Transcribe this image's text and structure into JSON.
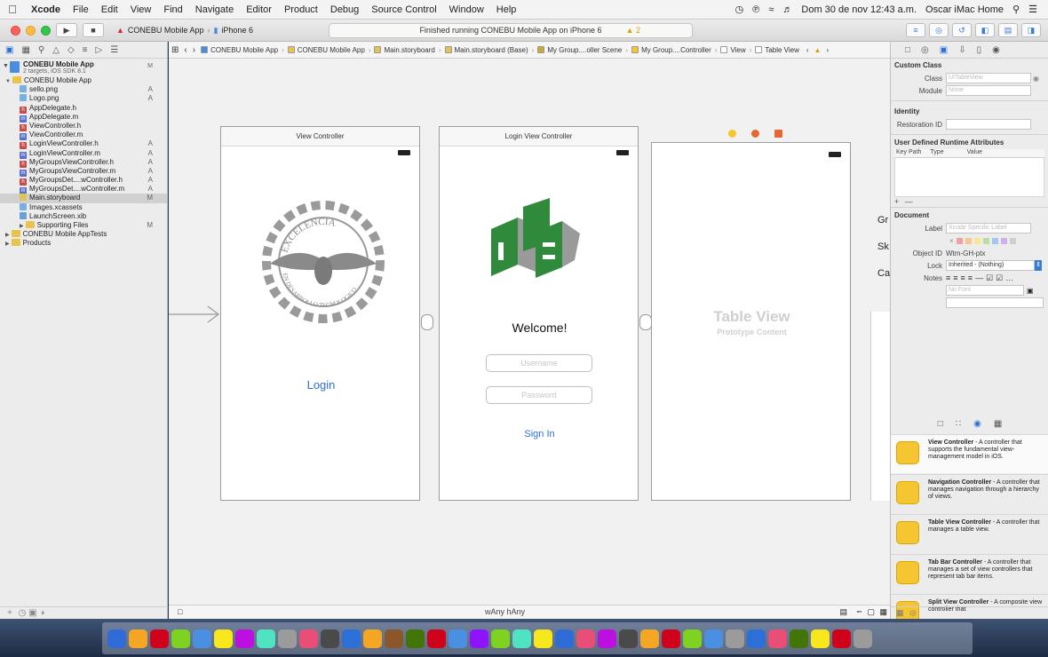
{
  "menubar": {
    "app": "Xcode",
    "items": [
      "File",
      "Edit",
      "View",
      "Find",
      "Navigate",
      "Editor",
      "Product",
      "Debug",
      "Source Control",
      "Window",
      "Help"
    ],
    "clock": "Dom 30 de nov  12:43 a.m.",
    "user": "Oscar iMac Home"
  },
  "toolbar": {
    "scheme": "CONEBU Mobile App",
    "device": "iPhone 6",
    "status": "Finished running CONEBU Mobile App on iPhone 6",
    "warning_count": "2"
  },
  "navigator": {
    "project_name": "CONEBU Mobile App",
    "project_sub": "2 targets, iOS SDK 8.1",
    "project_badge": "M",
    "items": [
      {
        "name": "CONEBU Mobile App",
        "type": "folder",
        "indent": 1,
        "status": ""
      },
      {
        "name": "sello.png",
        "type": "img",
        "indent": 2,
        "status": "A"
      },
      {
        "name": "Logo.png",
        "type": "img",
        "indent": 2,
        "status": "A"
      },
      {
        "name": "AppDelegate.h",
        "type": "h",
        "indent": 2,
        "status": ""
      },
      {
        "name": "AppDelegate.m",
        "type": "m",
        "indent": 2,
        "status": ""
      },
      {
        "name": "ViewController.h",
        "type": "h",
        "indent": 2,
        "status": ""
      },
      {
        "name": "ViewController.m",
        "type": "m",
        "indent": 2,
        "status": ""
      },
      {
        "name": "LoginViewController.h",
        "type": "h",
        "indent": 2,
        "status": "A"
      },
      {
        "name": "LoginViewController.m",
        "type": "m",
        "indent": 2,
        "status": "A"
      },
      {
        "name": "MyGroupsViewController.h",
        "type": "h",
        "indent": 2,
        "status": "A"
      },
      {
        "name": "MyGroupsViewController.m",
        "type": "m",
        "indent": 2,
        "status": "A"
      },
      {
        "name": "MyGroupsDet....wController.h",
        "type": "h",
        "indent": 2,
        "status": "A"
      },
      {
        "name": "MyGroupsDet....wController.m",
        "type": "m",
        "indent": 2,
        "status": "A"
      },
      {
        "name": "Main.storyboard",
        "type": "sb",
        "indent": 2,
        "status": "M",
        "selected": true
      },
      {
        "name": "Images.xcassets",
        "type": "img",
        "indent": 2,
        "status": ""
      },
      {
        "name": "LaunchScreen.xib",
        "type": "xib",
        "indent": 2,
        "status": ""
      },
      {
        "name": "Supporting Files",
        "type": "folder",
        "indent": 2,
        "status": "M"
      },
      {
        "name": "CONEBU Mobile AppTests",
        "type": "folder",
        "indent": 1,
        "status": ""
      },
      {
        "name": "Products",
        "type": "folder",
        "indent": 1,
        "status": ""
      }
    ]
  },
  "jumpbar": {
    "crumbs": [
      "CONEBU Mobile App",
      "CONEBU Mobile App",
      "Main.storyboard",
      "Main.storyboard (Base)",
      "My Group....oller Scene",
      "My Group....Controller",
      "View",
      "Table View"
    ]
  },
  "canvas": {
    "scene1_title": "View Controller",
    "seal_text_top": "EXCELENCIA",
    "seal_text_bottom": "EN DESARROLLO TECNOLOGICO",
    "login_link": "Login",
    "scene2_title": "Login View Controller",
    "welcome": "Welcome!",
    "username_placeholder": "Username",
    "password_placeholder": "Password",
    "sign_in": "Sign In",
    "table_view": "Table View",
    "prototype_content": "Prototype Content",
    "side_labels": [
      "Gr",
      "Sk",
      "Ca"
    ],
    "size_class": "wAny hAny"
  },
  "inspector": {
    "custom_class": "Custom Class",
    "class_label": "Class",
    "class_placeholder": "UITableView",
    "module_label": "Module",
    "module_placeholder": "None",
    "identity": "Identity",
    "restoration_label": "Restoration ID",
    "udra": "User Defined Runtime Attributes",
    "udra_cols": [
      "Key Path",
      "Type",
      "Value"
    ],
    "document": "Document",
    "doc_label": "Label",
    "doc_label_placeholder": "Xcode Specific Label",
    "object_id_label": "Object ID",
    "object_id": "Wtm-GH-ptx",
    "lock_label": "Lock",
    "lock_value": "Inherited - (Nothing)",
    "notes_label": "Notes",
    "notes_font": "No Font",
    "library": [
      {
        "title": "View Controller",
        "desc": " - A controller that supports the fundamental view-management model in iOS."
      },
      {
        "title": "Navigation Controller",
        "desc": " - A controller that manages navigation through a hierarchy of views."
      },
      {
        "title": "Table View Controller",
        "desc": " - A controller that manages a table view."
      },
      {
        "title": "Tab Bar Controller",
        "desc": " - A controller that manages a set of view controllers that represent tab bar items."
      },
      {
        "title": "Split View Controller",
        "desc": " - A composite view controller that"
      }
    ]
  },
  "colors": {
    "isse_green": "#2f8a3c",
    "isse_gray": "#9a9a9a",
    "link_blue": "#2d6fd8",
    "seal_gray": "#888888"
  }
}
